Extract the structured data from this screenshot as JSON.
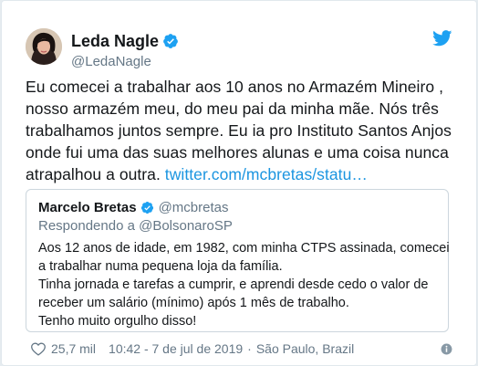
{
  "tweet": {
    "author_name": "Leda Nagle",
    "author_handle": "@LedaNagle",
    "text_lines": [
      "Eu comecei a trabalhar aos 10 anos no Armazém Mineiro ,",
      "nosso armazém meu, do meu pai da minha mãe. Nós três",
      "trabalhamos juntos sempre. Eu ia pro Instituto Santos Anjos",
      "onde fui uma das suas melhores alunas e uma coisa nunca",
      "atrapalhou a outra."
    ],
    "link_text": "twitter.com/mcbretas/statu…",
    "likes": "25,7 mil",
    "time": "10:42 - 7 de jul de 2019",
    "location": "São Paulo, Brazil",
    "separator": "·"
  },
  "quoted": {
    "author_name": "Marcelo Bretas",
    "author_handle": "@mcbretas",
    "reply_to": "Respondendo a @BolsonaroSP",
    "text_lines": [
      "Aos 12 anos de idade, em 1982, com minha CTPS assinada, comecei",
      "a trabalhar numa pequena loja da família.",
      "Tinha jornada e tarefas a cumprir, e aprendi desde cedo o valor de",
      "receber um salário (mínimo) após 1 mês de trabalho.",
      "Tenho muito orgulho disso!"
    ]
  },
  "icons": {
    "brand": "twitter-bird-icon",
    "verified": "verified-badge-icon",
    "like": "heart-icon",
    "info": "info-icon"
  },
  "colors": {
    "brand_blue": "#1da1f2",
    "link": "#1b95e0",
    "muted": "#657786",
    "text": "#14171a",
    "border": "#ccd6dd"
  }
}
